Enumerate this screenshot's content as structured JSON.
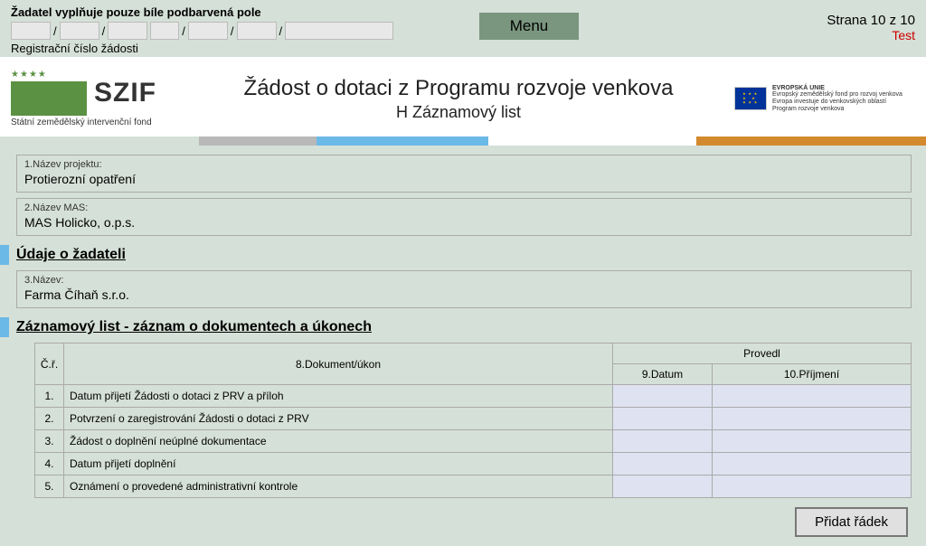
{
  "topNote": "Žadatel vyplňuje pouze bíle podbarvená pole",
  "regLabel": "Registrační číslo žádosti",
  "menuLabel": "Menu",
  "pageInfo": "Strana 10 z 10",
  "testLabel": "Test",
  "szif": {
    "text": "SZIF",
    "sub": "Státní zemědělský intervenční fond"
  },
  "title1": "Žádost o dotaci z Programu rozvoje venkova",
  "title2": "H Záznamový list",
  "eu": {
    "l1": "EVROPSKÁ UNIE",
    "l2": "Evropský zemědělský fond pro rozvoj venkova",
    "l3": "Evropa investuje do venkovských oblastí",
    "l4": "Program rozvoje venkova"
  },
  "field1": {
    "label": "1.Název projektu:",
    "value": "Protierozní opatření"
  },
  "field2": {
    "label": "2.Název MAS:",
    "value": "MAS Holicko, o.p.s."
  },
  "sectionApplicant": "Údaje o žadateli",
  "field3": {
    "label": "3.Název:",
    "value": "Farma Číhaň s.r.o."
  },
  "sectionLog": "Záznamový list - záznam o dokumentech a úkonech",
  "headers": {
    "cr": "Č.ř.",
    "doc": "8.Dokument/úkon",
    "group": "Provedl",
    "date": "9.Datum",
    "surname": "10.Příjmení"
  },
  "rows": [
    {
      "n": "1.",
      "doc": "Datum přijetí Žádosti o dotaci z PRV a příloh",
      "date": "",
      "surname": ""
    },
    {
      "n": "2.",
      "doc": "Potvrzení o zaregistrování Žádosti o dotaci z PRV",
      "date": "",
      "surname": ""
    },
    {
      "n": "3.",
      "doc": "Žádost o doplnění neúplné dokumentace",
      "date": "",
      "surname": ""
    },
    {
      "n": "4.",
      "doc": "Datum přijetí doplnění",
      "date": "",
      "surname": ""
    },
    {
      "n": "5.",
      "doc": "Oznámení o provedené administrativní kontrole",
      "date": "",
      "surname": ""
    }
  ],
  "addRow": "Přidat řádek"
}
